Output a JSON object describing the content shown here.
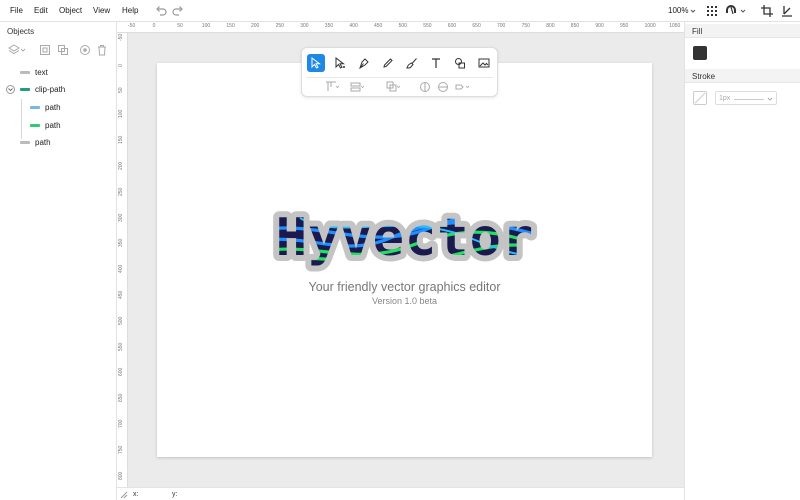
{
  "menu": {
    "file": "File",
    "edit": "Edit",
    "object": "Object",
    "view": "View",
    "help": "Help"
  },
  "toolbar": {
    "zoom": "100%"
  },
  "left_panel": {
    "title": "Objects",
    "tree": [
      {
        "label": "text",
        "color": "#bbbbbb"
      },
      {
        "label": "clip-path",
        "color": "#1e9e7a"
      },
      {
        "label": "path",
        "color": "#7ab7e6"
      },
      {
        "label": "path",
        "color": "#2ecc71"
      },
      {
        "label": "path",
        "color": "#bbbbbb"
      }
    ]
  },
  "ruler_h": [
    "-50",
    "0",
    "50",
    "100",
    "150",
    "200",
    "250",
    "300",
    "350",
    "400",
    "450",
    "500",
    "550",
    "600",
    "650",
    "700",
    "750",
    "800",
    "850",
    "900",
    "950",
    "1000",
    "1050"
  ],
  "ruler_v": [
    "-50",
    "0",
    "50",
    "100",
    "150",
    "200",
    "250",
    "300",
    "350",
    "400",
    "450",
    "500",
    "550",
    "600",
    "650",
    "700",
    "750",
    "800"
  ],
  "canvas": {
    "logo_text": "Hyvector",
    "subtitle": "Your friendly vector graphics editor",
    "version": "Version 1.0 beta"
  },
  "status": {
    "x_label": "x:",
    "y_label": "y:"
  },
  "right_panel": {
    "fill_label": "Fill",
    "fill_color": "#333333",
    "stroke_label": "Stroke",
    "stroke_width": "1px"
  },
  "colors": {
    "accent": "#1e88e5",
    "logo_dark": "#1a1a4e",
    "logo_blue": "#1e90ff",
    "logo_green": "#21e060"
  }
}
